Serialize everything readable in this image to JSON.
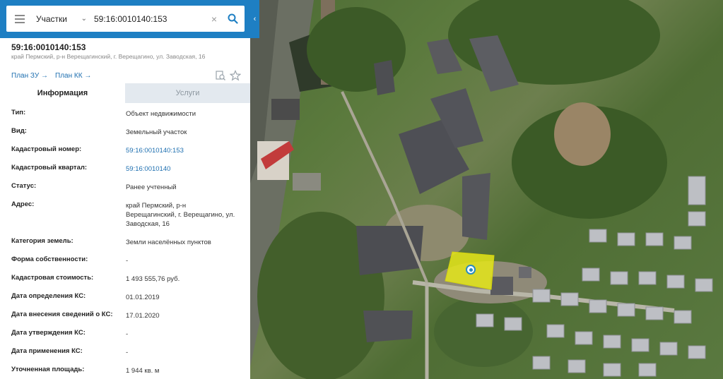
{
  "search": {
    "layer": "Участки",
    "query": "59:16:0010140:153"
  },
  "object": {
    "number": "59:16:0010140:153",
    "address_short": "край Пермский, р-н Верещагинский, г. Верещагино, ул. Заводская, 16",
    "plan_zu": "План ЗУ →",
    "plan_kk": "План КК →"
  },
  "tabs": [
    {
      "label": "Информация",
      "active": true
    },
    {
      "label": "Услуги",
      "active": false
    }
  ],
  "fields": [
    {
      "label": "Тип:",
      "value": "Объект недвижимости"
    },
    {
      "label": "Вид:",
      "value": "Земельный участок"
    },
    {
      "label": "Кадастровый номер:",
      "value": "59:16:0010140:153",
      "link": true
    },
    {
      "label": "Кадастровый квартал:",
      "value": "59:16:0010140",
      "link": true
    },
    {
      "label": "Статус:",
      "value": "Ранее учтенный"
    },
    {
      "label": "Адрес:",
      "value": "край Пермский, р-н Верещагинский, г. Верещагино, ул. Заводская, 16"
    },
    {
      "label": "Категория земель:",
      "value": "Земли населённых пунктов"
    },
    {
      "label": "Форма собственности:",
      "value": "-"
    },
    {
      "label": "Кадастровая стоимость:",
      "value": "1 493 555,76 руб."
    },
    {
      "label": "Дата определения КС:",
      "value": "01.01.2019"
    },
    {
      "label": "Дата внесения сведений о КС:",
      "value": "17.01.2020"
    },
    {
      "label": "Дата утверждения КС:",
      "value": "-"
    },
    {
      "label": "Дата применения КС:",
      "value": "-"
    },
    {
      "label": "Уточненная площадь:",
      "value": "1 944 кв. м"
    }
  ],
  "icons": {
    "menu": "hamburger-icon",
    "dropdown": "chevron-down-icon",
    "clear": "close-icon",
    "search": "search-icon",
    "collapse": "chevron-left-icon",
    "print": "document-search-icon",
    "favorite": "star-icon",
    "marker": "location-marker-icon"
  },
  "colors": {
    "header": "#1e7fc3",
    "link": "#1e6fb0",
    "parcel_highlight": "#e5e619"
  }
}
